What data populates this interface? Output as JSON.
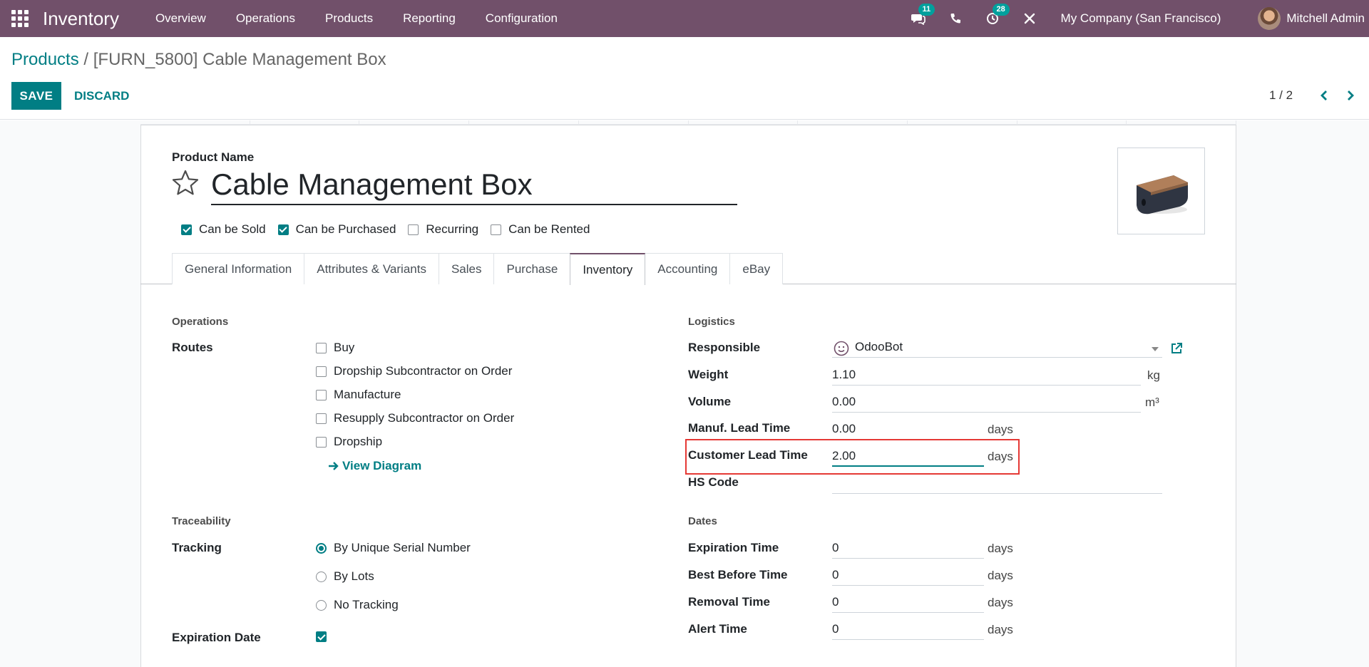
{
  "navbar": {
    "app_title": "Inventory",
    "menu": [
      "Overview",
      "Operations",
      "Products",
      "Reporting",
      "Configuration"
    ],
    "messages_badge": "11",
    "activities_badge": "28",
    "company": "My Company (San Francisco)",
    "user": "Mitchell Admin",
    "bg_color": "#71506a"
  },
  "breadcrumb": {
    "parent": "Products",
    "separator": "/",
    "current": "[FURN_5800] Cable Management Box"
  },
  "actions": {
    "save": "SAVE",
    "discard": "DISCARD"
  },
  "pager": {
    "value": "1 / 2"
  },
  "product": {
    "name_label": "Product Name",
    "name": "Cable Management Box",
    "flags": [
      {
        "label": "Can be Sold",
        "checked": true
      },
      {
        "label": "Can be Purchased",
        "checked": true
      },
      {
        "label": "Recurring",
        "checked": false
      },
      {
        "label": "Can be Rented",
        "checked": false
      }
    ]
  },
  "tabs": [
    "General Information",
    "Attributes & Variants",
    "Sales",
    "Purchase",
    "Inventory",
    "Accounting",
    "eBay"
  ],
  "active_tab": "Inventory",
  "operations": {
    "title": "Operations",
    "routes_label": "Routes",
    "routes": [
      {
        "label": "Buy",
        "checked": false
      },
      {
        "label": "Dropship Subcontractor on Order",
        "checked": false
      },
      {
        "label": "Manufacture",
        "checked": false
      },
      {
        "label": "Resupply Subcontractor on Order",
        "checked": false
      },
      {
        "label": "Dropship",
        "checked": false
      }
    ],
    "view_diagram": "View Diagram"
  },
  "traceability": {
    "title": "Traceability",
    "tracking_label": "Tracking",
    "options": [
      {
        "label": "By Unique Serial Number",
        "checked": true
      },
      {
        "label": "By Lots",
        "checked": false
      },
      {
        "label": "No Tracking",
        "checked": false
      }
    ],
    "expiration_label": "Expiration Date",
    "expiration_checked": true
  },
  "logistics": {
    "title": "Logistics",
    "responsible_label": "Responsible",
    "responsible_value": "OdooBot",
    "weight_label": "Weight",
    "weight_value": "1.10",
    "weight_unit": "kg",
    "volume_label": "Volume",
    "volume_value": "0.00",
    "volume_unit": "m³",
    "manuf_label": "Manuf. Lead Time",
    "manuf_value": "0.00",
    "manuf_unit": "days",
    "customer_label": "Customer Lead Time",
    "customer_value": "2.00",
    "customer_unit": "days",
    "hs_label": "HS Code",
    "hs_value": ""
  },
  "dates": {
    "title": "Dates",
    "expiration_time_label": "Expiration Time",
    "expiration_time_value": "0",
    "best_before_label": "Best Before Time",
    "best_before_value": "0",
    "removal_label": "Removal Time",
    "removal_value": "0",
    "alert_label": "Alert Time",
    "alert_value": "0",
    "unit": "days"
  }
}
